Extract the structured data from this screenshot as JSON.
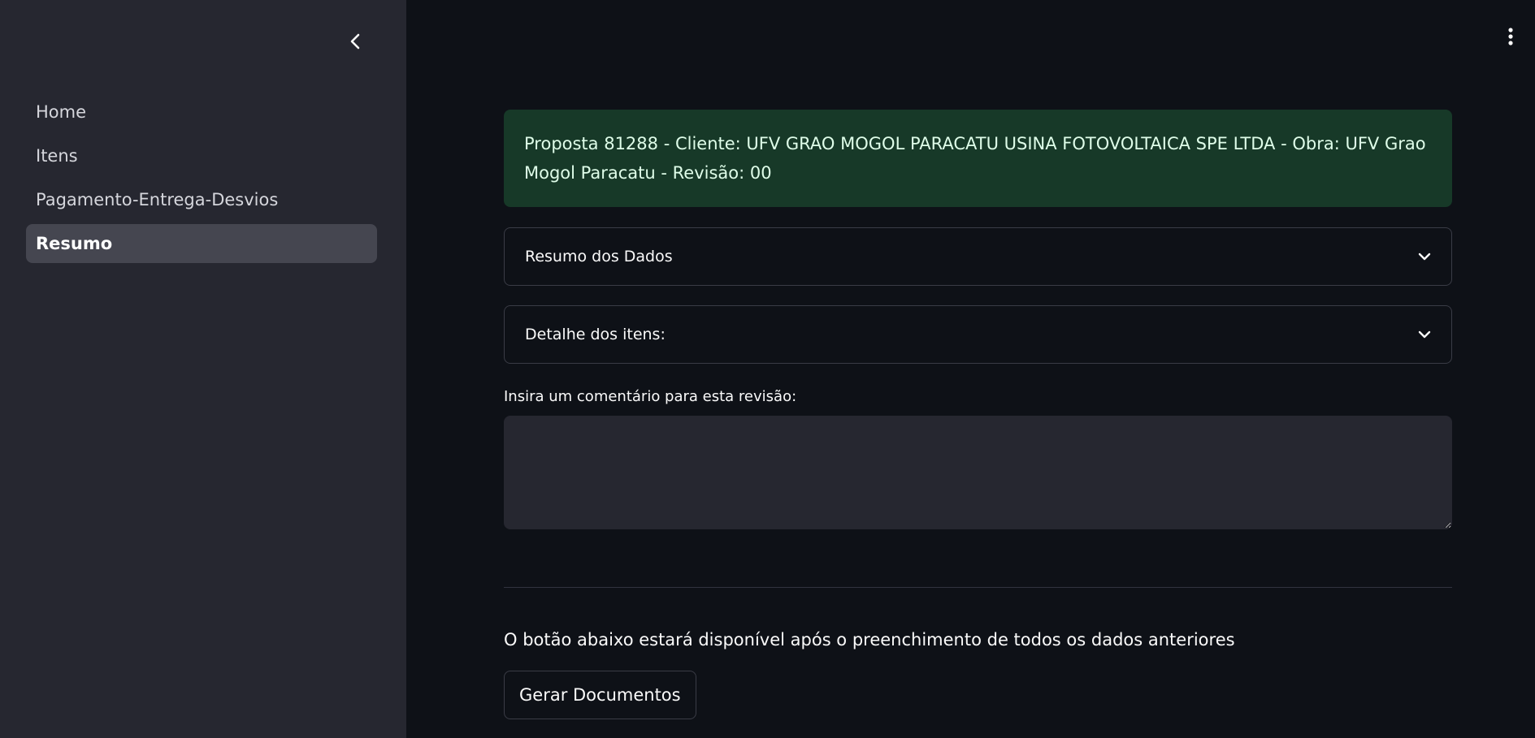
{
  "sidebar": {
    "collapse_icon": "chevron-left-icon",
    "items": [
      {
        "label": "Home",
        "active": false
      },
      {
        "label": "Itens",
        "active": false
      },
      {
        "label": "Pagamento-Entrega-Desvios",
        "active": false
      },
      {
        "label": "Resumo",
        "active": true
      }
    ]
  },
  "header": {
    "menu_icon": "kebab-menu-icon"
  },
  "main": {
    "alert_text": "Proposta 81288 - Cliente: UFV GRAO MOGOL PARACATU USINA FOTOVOLTAICA SPE LTDA - Obra: UFV Grao Mogol Paracatu - Revisão: 00",
    "expanders": [
      {
        "label": "Resumo dos Dados",
        "icon": "chevron-down-icon"
      },
      {
        "label": "Detalhe dos itens:",
        "icon": "chevron-down-icon"
      }
    ],
    "comment_label": "Insira um comentário para esta revisão:",
    "comment_value": "",
    "info_text": "O botão abaixo estará disponível após o preenchimento de todos os dados anteriores",
    "generate_button_label": "Gerar Documentos"
  },
  "colors": {
    "sidebar_bg": "#262730",
    "main_bg": "#0e1117",
    "alert_bg": "#173928",
    "alert_text": "#dffde9",
    "active_nav_bg": "#454650"
  }
}
